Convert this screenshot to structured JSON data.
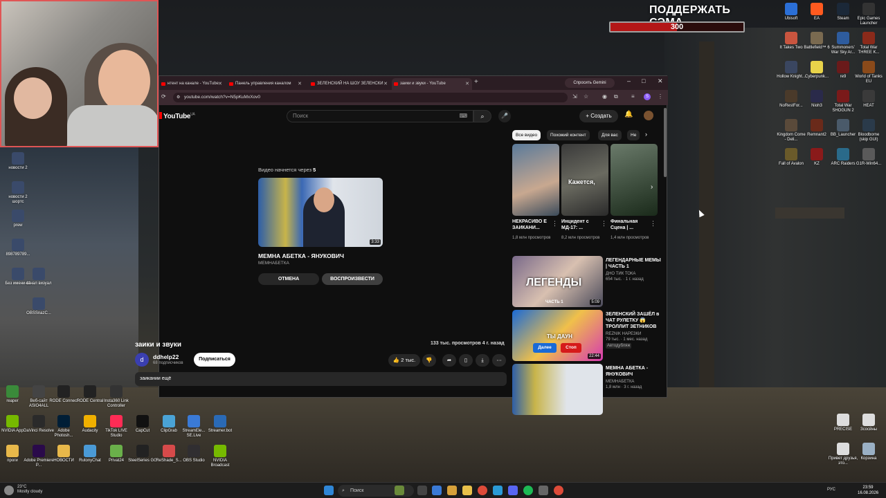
{
  "overlay": {
    "donate_title": "ПОДДЕРЖАТЬ СЭМА",
    "donate_value": "300",
    "donate_fraction": 0.5
  },
  "desktop_left": [
    {
      "label": "новости 2"
    },
    {
      "label": "новости 2 шортс"
    },
    {
      "label": "prew"
    },
    {
      "label": "898789789..."
    },
    {
      "label": "Без имени-11"
    },
    {
      "label": "канал визуал"
    },
    {
      "label": "OBSSnazC..."
    }
  ],
  "desktop_right": [
    {
      "label": "Ubisoft",
      "color": "#2b6fd6"
    },
    {
      "label": "EA",
      "color": "#ff5a1f"
    },
    {
      "label": "Steam",
      "color": "#1b2838"
    },
    {
      "label": "Epic Games Launcher",
      "color": "#333333"
    },
    {
      "label": "It Takes Two",
      "color": "#c9553f"
    },
    {
      "label": "Battlefield™ 6",
      "color": "#7a6a50"
    },
    {
      "label": "Summoners' War Sky Ar...",
      "color": "#2e5c9e"
    },
    {
      "label": "Total War THREE K...",
      "color": "#8a2a1a"
    },
    {
      "label": "Hollow Knight...",
      "color": "#3a4660"
    },
    {
      "label": "Cyberpunk...",
      "color": "#e8d34a"
    },
    {
      "label": "re9",
      "color": "#6a1a1a"
    },
    {
      "label": "World of Tanks EU",
      "color": "#8a4a1a"
    },
    {
      "label": "NoRestFor...",
      "color": "#4a3a2a"
    },
    {
      "label": "Nioh3",
      "color": "#2a2a4a"
    },
    {
      "label": "Total War SHOGUN 2",
      "color": "#7a1a1a"
    },
    {
      "label": "HEAT",
      "color": "#3a3a3a"
    },
    {
      "label": "Kingdom Come - Deli...",
      "color": "#5a4a3a"
    },
    {
      "label": "Remnant2",
      "color": "#6a2a1a"
    },
    {
      "label": "BB_Launcher",
      "color": "#4a5a6a"
    },
    {
      "label": "Bloodborne (skip GUI)",
      "color": "#2a3a4a"
    },
    {
      "label": "Fall of Avalon",
      "color": "#6a5a2a"
    },
    {
      "label": "KZ",
      "color": "#8a1a1a"
    },
    {
      "label": "ARC Raiders",
      "color": "#2a6a8a"
    },
    {
      "label": "G1R-Win64...",
      "color": "#5a5a5a"
    },
    {
      "label": "PRECISE",
      "color": "#dddddd"
    },
    {
      "label": "Зсосйны",
      "color": "#dddddd"
    },
    {
      "label": "Привет друзья, это...",
      "color": "#dddddd"
    },
    {
      "label": "Корзина",
      "color": "#9ab0c4"
    }
  ],
  "desktop_bottom": [
    {
      "label": "reaper",
      "color": "#3a8a3a"
    },
    {
      "label": "Веб-сайт ASIO4ALL",
      "color": "#444444"
    },
    {
      "label": "RODE Connect",
      "color": "#222222"
    },
    {
      "label": "RODE Central",
      "color": "#222222"
    },
    {
      "label": "Insta360 Link Controller",
      "color": "#333333"
    },
    {
      "label": "NVIDIA App",
      "color": "#76b900"
    },
    {
      "label": "DaVinci Resolve",
      "color": "#2a2a2a"
    },
    {
      "label": "Adobe Photosh...",
      "color": "#001e36"
    },
    {
      "label": "Audacity",
      "color": "#f0b000"
    },
    {
      "label": "TikTok LIVE Studio",
      "color": "#fe2c55"
    },
    {
      "label": "CapCut",
      "color": "#111111"
    },
    {
      "label": "ClipGrab",
      "color": "#4aa3d6"
    },
    {
      "label": "StreamEle... SE.Live",
      "color": "#3a7ad6"
    },
    {
      "label": "Streamer.bot",
      "color": "#2a6ab6"
    },
    {
      "label": "проги",
      "color": "#e8b84a"
    },
    {
      "label": "Adobe Premiere P...",
      "color": "#2a0a4a"
    },
    {
      "label": "НОВОСТИ",
      "color": "#e8b84a"
    },
    {
      "label": "RutonyChat",
      "color": "#4a9ad6"
    },
    {
      "label": "Privat24",
      "color": "#6ab04a"
    },
    {
      "label": "SteelSeries GG",
      "color": "#222222"
    },
    {
      "label": "ReShade_S...",
      "color": "#d64a4a"
    },
    {
      "label": "OBS Studio",
      "color": "#302e31"
    },
    {
      "label": "NVIDIA Broadcast",
      "color": "#76b900"
    }
  ],
  "browser": {
    "tabs": [
      {
        "label": "нтент на канале - YouTube"
      },
      {
        "label": "Панель управления каналом"
      },
      {
        "label": "ЗЕЛЕНСКИЙ НА ШОУ ЗЕЛЕНСКИ"
      },
      {
        "label": "заики и звуки - YouTube"
      }
    ],
    "gemini": "Спросить Gemini",
    "url": "youtube.com/watch?v=N5pKuMxXov0",
    "profile_initial": "S"
  },
  "youtube": {
    "logo": "YouTube",
    "region": "UA",
    "search_placeholder": "Поиск",
    "create_label": "Создать",
    "endcard": {
      "countdown_prefix": "Видео начнется через",
      "countdown": "5",
      "duration": "3:33",
      "title": "МЕМНА АБЕТКА - ЯНУКОВИЧ",
      "channel": "МЕМНАБЕТКА",
      "cancel": "ОТМЕНА",
      "play": "ВОСПРОИЗВЕСТИ"
    },
    "video": {
      "title": "заики и звуки",
      "views": "133 тыс. просмотров  4 г. назад",
      "channel": "ddhelp22",
      "channel_initial": "d",
      "subs": "68 подписчиков",
      "subscribe": "Подписаться",
      "likes": "2 тыс.",
      "description": "заикании  ещё"
    },
    "chips": [
      "Все видео",
      "Похожий контент",
      "Для вас",
      "Не"
    ],
    "shorts": [
      {
        "title": "НЕКРАСИВО Е ЗАИКАНИ...",
        "meta": "1,8 млн просмотров",
        "caption": ""
      },
      {
        "title": "Инцидент с МД-17: ...",
        "meta": "8,2 млн просмотров",
        "caption": "Кажется,"
      },
      {
        "title": "Финальная Сцена | ...",
        "meta": "1,4 млн просмотров",
        "caption": ""
      }
    ],
    "recs": [
      {
        "title": "ЛЕГЕНДАРНЫЕ МЕМЫ | ЧАСТЬ 1",
        "channel": "ДНО ТИК ТОКА",
        "meta": "654 тыс. · 1 г. назад",
        "overlay": "ЛЕГЕНДЫ",
        "sub": "ЧАСТЬ 1",
        "duration": "5:09"
      },
      {
        "title": "ЗЕЛЕНСКИЙ ЗАШЁЛ в ЧАТ РУЛЕТКУ 😱 ТРОЛЛИТ ЗЕТНИКОВ",
        "channel": "REZNIK НАРЕЗКИ",
        "meta": "79 тыс. · 1 мес. назад",
        "badge": "Автодубляж",
        "overlay": "ТЫ ДАУН",
        "duration": "22:44",
        "next": "Далее",
        "stop": "Стоп"
      },
      {
        "title": "МЕМНА АБЕТКА - ЯНУКОВИЧ",
        "channel": "МЕМНАБЕТКА",
        "meta": "1,8 млн · 3 г. назад",
        "duration": ""
      }
    ]
  },
  "taskbar": {
    "temp": "23°C",
    "weather": "Mostly cloudy",
    "search": "Поиск",
    "lang": "РУС",
    "time": "23:59",
    "date": "16.08.2026"
  }
}
